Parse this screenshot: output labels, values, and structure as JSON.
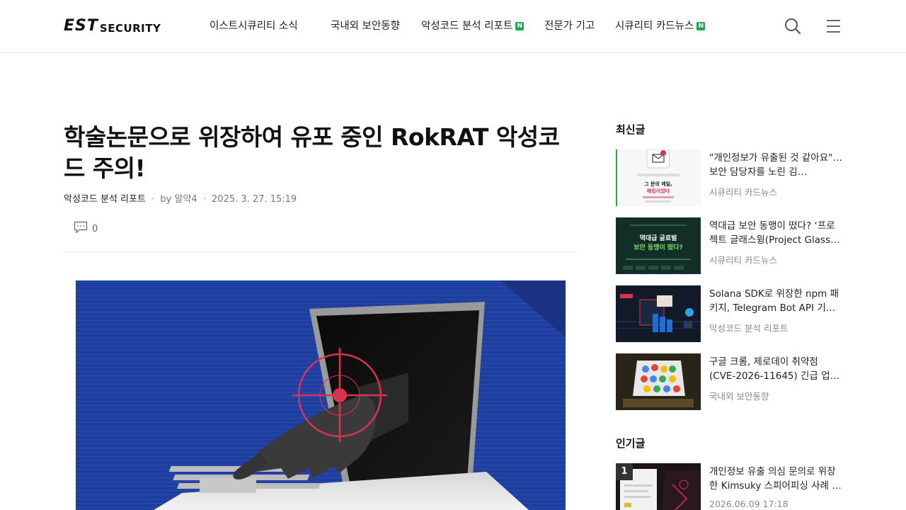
{
  "header": {
    "logo_est": "EST",
    "logo_security": "SECURITY",
    "nav": [
      {
        "label": "이스트시큐리티 소식",
        "badge": ""
      },
      {
        "label": "국내외 보안동향",
        "badge": ""
      },
      {
        "label": "악성코드 분석 리포트",
        "badge": "N"
      },
      {
        "label": "전문가 기고",
        "badge": ""
      },
      {
        "label": "시큐리티 카드뉴스",
        "badge": "N"
      }
    ],
    "search_icon": "search-icon",
    "menu_icon": "hamburger-menu-icon"
  },
  "article": {
    "title": "학술논문으로 위장하여 유포 중인 RokRAT 악성코드 주의!",
    "category": "악성코드 분석 리포트",
    "author": "by 알약4",
    "date": "2025. 3. 27. 15:19",
    "comment_count": "0"
  },
  "sidebar": {
    "recent_title": "최신글",
    "recent": [
      {
        "title": "\"개인정보가 유출된 것 같아요\"… 보안 담당자를 노린 김…",
        "category": "시큐리티 카드뉴스"
      },
      {
        "title": "역대급 보안 동맹이 떴다? ‘프로젝트 글래스윙(Project Glass…",
        "category": "시큐리티 카드뉴스"
      },
      {
        "title": "Solana SDK로 위장한 npm 패키지, Telegram Bot API 기반…",
        "category": "악성코드 분석 리포트"
      },
      {
        "title": "구글 크롬, 제로데이 취약점(CVE-2026-11645) 긴급 업데이…",
        "category": "국내외 보안동향"
      }
    ],
    "popular_title": "인기글",
    "popular": [
      {
        "rank": "1",
        "title": "개인정보 유출 의심 문의로 위장한 Kimsuky 스피어피싱 사례 …",
        "date": "2026.06.09 17:18"
      }
    ],
    "thumb_texts": {
      "t1_line1": "그 문의 메일,",
      "t1_line2": "해킹이었다",
      "t2_line1": "역대급 글로벌",
      "t2_line2": "보안 동맹이 떴다?"
    }
  },
  "colors": {
    "badge_green": "#1aa84a",
    "hero_blue": "#1f3fa0",
    "target_red": "#d9344f"
  }
}
